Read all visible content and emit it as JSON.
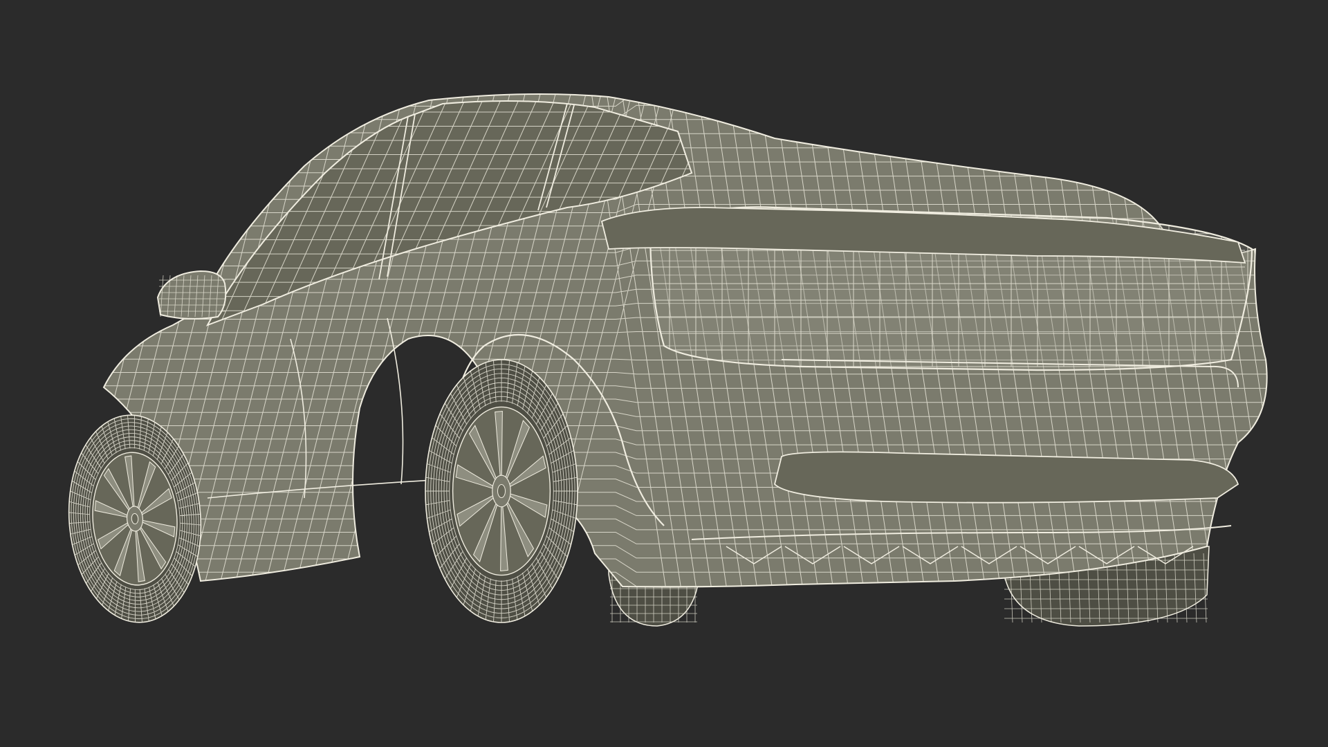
{
  "viewport": {
    "background_color": "#2b2b2b",
    "model_fill_color": "#7b7b6d",
    "model_fill_dark": "#676759",
    "model_fill_light": "#8e8e80",
    "wire_color": "#f0ede0",
    "tire_color": "#4e4e44",
    "model_description_icon": "wireframe-car-icon"
  }
}
